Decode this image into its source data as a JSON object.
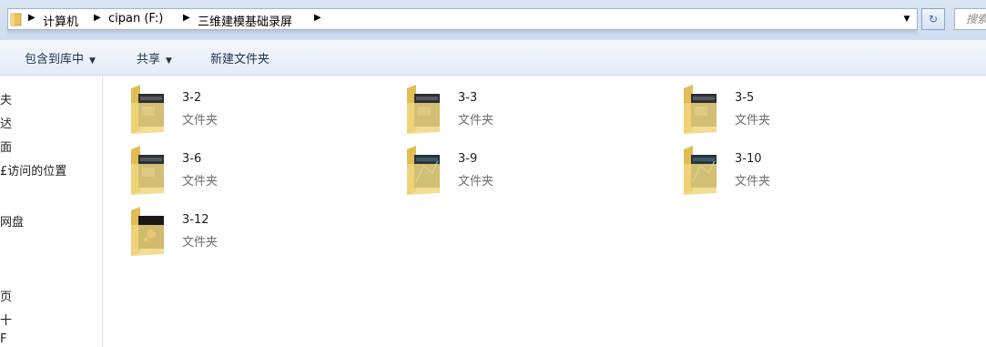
{
  "address": {
    "breadcrumbs": [
      "计算机",
      "cipan (F:)",
      "三维建模基础录屏"
    ],
    "search_placeholder": "搜索"
  },
  "toolbar": {
    "include_in_library": "包含到库中",
    "share": "共享",
    "new_folder": "新建文件夹"
  },
  "nav": {
    "items": [
      "夫",
      "迖",
      "面",
      "£访问的位置",
      "网盘",
      "页",
      "十",
      "F"
    ]
  },
  "folders": [
    {
      "name": "3-2",
      "type": "文件夹",
      "thumb": "dark-ui"
    },
    {
      "name": "3-3",
      "type": "文件夹",
      "thumb": "dark-ui"
    },
    {
      "name": "3-5",
      "type": "文件夹",
      "thumb": "dark-ui"
    },
    {
      "name": "3-6",
      "type": "文件夹",
      "thumb": "dark-ui"
    },
    {
      "name": "3-9",
      "type": "文件夹",
      "thumb": "teal-ui"
    },
    {
      "name": "3-10",
      "type": "文件夹",
      "thumb": "teal-ui"
    },
    {
      "name": "3-12",
      "type": "文件夹",
      "thumb": "dark-orange"
    }
  ]
}
